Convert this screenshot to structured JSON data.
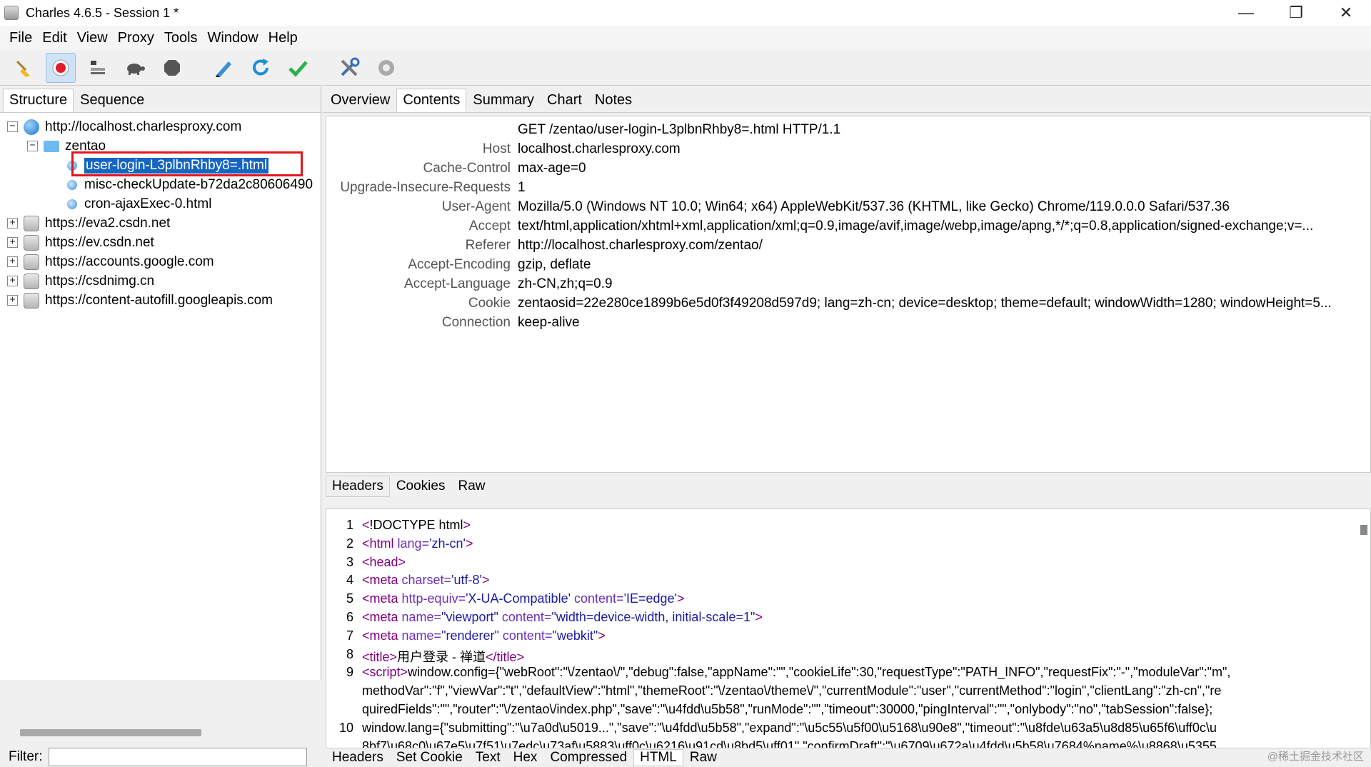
{
  "window": {
    "title": "Charles 4.6.5 - Session 1 *",
    "controls": [
      "—",
      "❐",
      "✕"
    ]
  },
  "menu": [
    {
      "label": "File"
    },
    {
      "label": "Edit"
    },
    {
      "label": "View"
    },
    {
      "label": "Proxy"
    },
    {
      "label": "Tools"
    },
    {
      "label": "Window"
    },
    {
      "label": "Help"
    }
  ],
  "toolbar": {
    "icons": [
      "broom-icon",
      "record-icon",
      "throttle-icon",
      "turtle-icon",
      "stop-icon",
      "pen-icon",
      "refresh-icon",
      "check-icon",
      "tools-icon",
      "settings-icon"
    ],
    "record_color": "#e01e2b"
  },
  "left": {
    "tabs": [
      {
        "label": "Structure"
      },
      {
        "label": "Sequence"
      }
    ],
    "tree": [
      {
        "label": "http://localhost.charlesproxy.com",
        "icon": "globe",
        "expander": "−"
      },
      {
        "label": "zentao",
        "icon": "folder",
        "expander": "−"
      },
      {
        "label": "user-login-L3plbnRhby8=.html",
        "icon": "doc",
        "selected": true
      },
      {
        "label": "misc-checkUpdate-b72da2c80606490",
        "icon": "doc"
      },
      {
        "label": "cron-ajaxExec-0.html",
        "icon": "doc"
      },
      {
        "label": "https://eva2.csdn.net",
        "icon": "lock",
        "expander": "+"
      },
      {
        "label": "https://ev.csdn.net",
        "icon": "lock",
        "expander": "+"
      },
      {
        "label": "https://accounts.google.com",
        "icon": "lock",
        "expander": "+"
      },
      {
        "label": "https://csdnimg.cn",
        "icon": "lock",
        "expander": "+"
      },
      {
        "label": "https://content-autofill.googleapis.com",
        "icon": "lock",
        "expander": "+"
      }
    ],
    "filter_label": "Filter:",
    "filter_value": ""
  },
  "right": {
    "tabs": [
      {
        "label": "Overview"
      },
      {
        "label": "Contents"
      },
      {
        "label": "Summary"
      },
      {
        "label": "Chart"
      },
      {
        "label": "Notes"
      }
    ],
    "request_line": "GET /zentao/user-login-L3plbnRhby8=.html HTTP/1.1",
    "headers": [
      {
        "name": "Host",
        "value": "localhost.charlesproxy.com"
      },
      {
        "name": "Cache-Control",
        "value": "max-age=0"
      },
      {
        "name": "Upgrade-Insecure-Requests",
        "value": "1"
      },
      {
        "name": "User-Agent",
        "value": "Mozilla/5.0 (Windows NT 10.0; Win64; x64) AppleWebKit/537.36 (KHTML, like Gecko) Chrome/119.0.0.0 Safari/537.36"
      },
      {
        "name": "Accept",
        "value": "text/html,application/xhtml+xml,application/xml;q=0.9,image/avif,image/webp,image/apng,*/*;q=0.8,application/signed-exchange;v=..."
      },
      {
        "name": "Referer",
        "value": "http://localhost.charlesproxy.com/zentao/"
      },
      {
        "name": "Accept-Encoding",
        "value": "gzip, deflate"
      },
      {
        "name": "Accept-Language",
        "value": "zh-CN,zh;q=0.9"
      },
      {
        "name": "Cookie",
        "value": "zentaosid=22e280ce1899b6e5d0f3f49208d597d9; lang=zh-cn; device=desktop; theme=default; windowWidth=1280; windowHeight=5..."
      },
      {
        "name": "Connection",
        "value": "keep-alive"
      }
    ],
    "request_subtabs": [
      {
        "label": "Headers"
      },
      {
        "label": "Cookies"
      },
      {
        "label": "Raw"
      }
    ],
    "code_lines": [
      {
        "n": "1",
        "parts": [
          [
            "t",
            "<"
          ],
          [
            "x",
            "!DOCTYPE html"
          ],
          [
            "t",
            ">"
          ]
        ]
      },
      {
        "n": "2",
        "parts": [
          [
            "t",
            "<html "
          ],
          [
            "a",
            "lang="
          ],
          [
            "s",
            "'zh-cn'"
          ],
          [
            "t",
            ">"
          ]
        ]
      },
      {
        "n": "3",
        "parts": [
          [
            "t",
            "<head>"
          ]
        ]
      },
      {
        "n": "4",
        "parts": [
          [
            "t",
            "  <meta "
          ],
          [
            "a",
            "charset="
          ],
          [
            "s",
            "'utf-8'"
          ],
          [
            "t",
            ">"
          ]
        ]
      },
      {
        "n": "5",
        "parts": [
          [
            "t",
            "  <meta "
          ],
          [
            "a",
            "http-equiv="
          ],
          [
            "s",
            "'X-UA-Compatible' "
          ],
          [
            "a",
            "content="
          ],
          [
            "s",
            "'IE=edge'"
          ],
          [
            "t",
            ">"
          ]
        ]
      },
      {
        "n": "6",
        "parts": [
          [
            "t",
            "  <meta "
          ],
          [
            "a",
            "name="
          ],
          [
            "s",
            "\"viewport\" "
          ],
          [
            "a",
            "content="
          ],
          [
            "s",
            "\"width=device-width, initial-scale=1\""
          ],
          [
            "t",
            ">"
          ]
        ]
      },
      {
        "n": "7",
        "parts": [
          [
            "t",
            "  <meta "
          ],
          [
            "a",
            "name="
          ],
          [
            "s",
            "\"renderer\" "
          ],
          [
            "a",
            "content="
          ],
          [
            "s",
            "\"webkit\""
          ],
          [
            "t",
            ">"
          ]
        ]
      },
      {
        "n": "8",
        "parts": [
          [
            "t",
            "  <title>"
          ],
          [
            "x",
            "用户登录 - 禅道"
          ],
          [
            "t",
            "</title>"
          ]
        ]
      },
      {
        "n": "9",
        "parts": [
          [
            "t",
            "<script>"
          ],
          [
            "x",
            "window.config={\"webRoot\":\"\\/zentao\\/\",\"debug\":false,\"appName\":\"\",\"cookieLife\":30,\"requestType\":\"PATH_INFO\",\"requestFix\":\"-\",\"moduleVar\":\"m\","
          ]
        ]
      },
      {
        "n": "",
        "parts": [
          [
            "x",
            "methodVar\":\"f\",\"viewVar\":\"t\",\"defaultView\":\"html\",\"themeRoot\":\"\\/zentao\\/theme\\/\",\"currentModule\":\"user\",\"currentMethod\":\"login\",\"clientLang\":\"zh-cn\",\"re"
          ]
        ]
      },
      {
        "n": "",
        "parts": [
          [
            "x",
            "quiredFields\":\"\",\"router\":\"\\/zentao\\/index.php\",\"save\":\"\\u4fdd\\u5b58\",\"runMode\":\"\",\"timeout\":30000,\"pingInterval\":\"\",\"onlybody\":\"no\",\"tabSession\":false};"
          ]
        ]
      },
      {
        "n": "10",
        "parts": [
          [
            "x",
            "window.lang={\"submitting\":\"\\u7a0d\\u5019...\",\"save\":\"\\u4fdd\\u5b58\",\"expand\":\"\\u5c55\\u5f00\\u5168\\u90e8\",\"timeout\":\"\\u8fde\\u63a5\\u8d85\\u65f6\\uff0c\\u"
          ]
        ]
      },
      {
        "n": "",
        "parts": [
          [
            "x",
            "8bf7\\u68c0\\u67e5\\u7f51\\u7edc\\u73af\\u5883\\uff0c\\u6216\\u91cd\\u8bd5\\uff01\",\"confirmDraft\":\"\\u6709\\u672a\\u4fdd\\u5b58\\u7684%name%\\u8868\\u5355"
          ]
        ]
      }
    ],
    "response_subtabs": [
      {
        "label": "Headers"
      },
      {
        "label": "Set Cookie"
      },
      {
        "label": "Text"
      },
      {
        "label": "Hex"
      },
      {
        "label": "Compressed"
      },
      {
        "label": "HTML"
      },
      {
        "label": "Raw"
      }
    ],
    "watermark": "@稀土掘金技术社区"
  },
  "colors": {
    "selection": "#1665c0",
    "highlight_box": "#e0181c",
    "tag": "#800080",
    "attr": "#6a2fb8",
    "string": "#1a1aa6"
  }
}
